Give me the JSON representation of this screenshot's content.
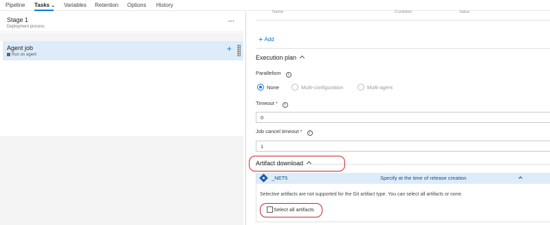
{
  "nav": {
    "tabs": [
      {
        "label": "Pipeline"
      },
      {
        "label": "Tasks"
      },
      {
        "label": "Variables"
      },
      {
        "label": "Retention"
      },
      {
        "label": "Options"
      },
      {
        "label": "History"
      }
    ],
    "active_tab": "Tasks",
    "accent_color": "#0078d4"
  },
  "stage": {
    "title": "Stage 1",
    "subtitle": "Deployment process",
    "more": "···"
  },
  "agent_job": {
    "title": "Agent job",
    "subtitle": "Run on agent",
    "selected_bg": "#deecf9"
  },
  "table_headers": {
    "name": "Name",
    "condition": "Condition",
    "value": "Value"
  },
  "add_label": "Add",
  "execution_plan": {
    "title": "Execution plan",
    "parallelism_label": "Parallelism",
    "options": [
      {
        "label": "None",
        "selected": true
      },
      {
        "label": "Multi-configuration",
        "selected": false
      },
      {
        "label": "Multi-agent",
        "selected": false
      }
    ],
    "timeout_label": "Timeout",
    "timeout_value": "0",
    "cancel_timeout_label": "Job cancel timeout",
    "cancel_timeout_value": "1",
    "required_mark": "*"
  },
  "artifact_download": {
    "title": "Artifact download",
    "artifact_name": "_NET5",
    "artifact_spec": "Specify at the time of release creation",
    "note": "Selective artifacts are not supported for the Git artifact type. You can select all artifacts or none.",
    "select_all_label": "Select all artifacts",
    "annotation_color": "#d01f2a"
  }
}
